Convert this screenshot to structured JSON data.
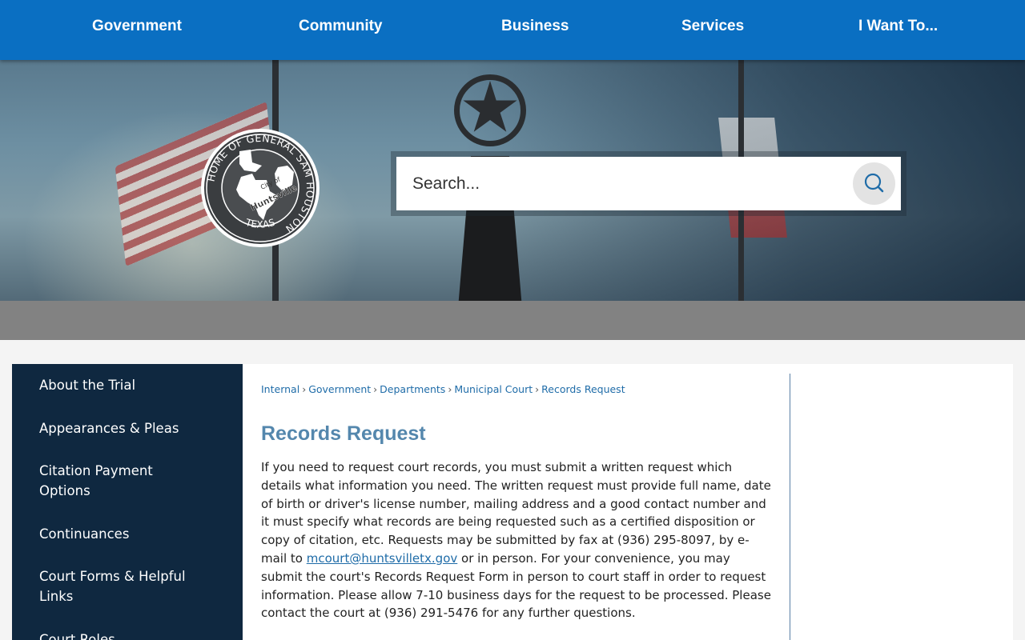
{
  "nav": {
    "items": [
      "Government",
      "Community",
      "Business",
      "Services",
      "I Want To..."
    ]
  },
  "seal": {
    "ring_text": "HOME OF GENERAL SAM HOUSTON",
    "bottom_text": "TEXAS",
    "city_of": "City of",
    "city_name": "Huntsville"
  },
  "search": {
    "placeholder": "Search..."
  },
  "sidebar": {
    "items": [
      "About the Trial",
      "Appearances & Pleas",
      "Citation Payment Options",
      "Continuances",
      "Court Forms & Helpful Links",
      "Court Roles"
    ]
  },
  "breadcrumb": [
    "Internal",
    "Government",
    "Departments",
    "Municipal Court",
    "Records Request"
  ],
  "page": {
    "title": "Records Request",
    "body_part1": "If you need to request court records, you must submit a written request which details what information you need.  The written request must provide full name, date of birth or driver's license number, mailing address and a good contact number and it must specify what records are being requested such as a certified disposition or copy of citation, etc.  Requests may be submitted by fax at (936) 295-8097, by e-mail to ",
    "email": "mcourt@huntsvilletx.gov",
    "body_part2": " or in person. For your convenience, you may submit the court's Records Request Form in person to court staff in order to request information. Please allow 7-10 business days for the request to be processed. Please contact the court at (936) 291-5476 for any further questions."
  },
  "colors": {
    "nav_bg": "#0a6fc2",
    "sidebar_bg": "#0f2840",
    "title": "#5487ad",
    "link": "#1f6ca8"
  }
}
